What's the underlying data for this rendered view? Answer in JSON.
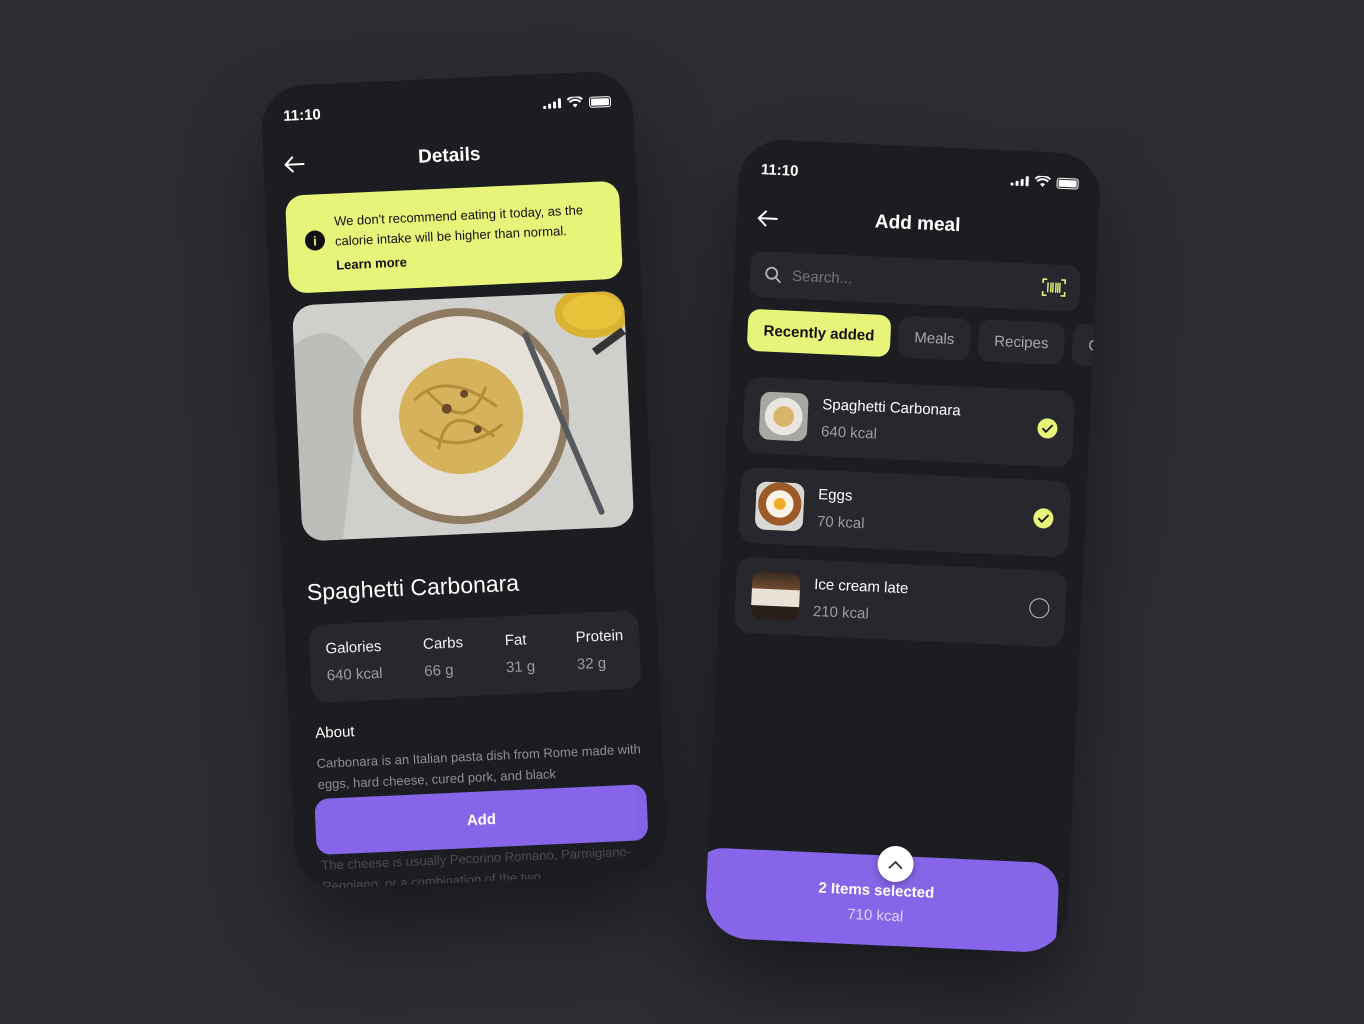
{
  "details_screen": {
    "status_time": "11:10",
    "title": "Details",
    "alert": {
      "message": "We don't recommend eating it today, as the calorie intake will be higher than normal.",
      "link": "Learn more"
    },
    "dish_name": "Spaghetti Carbonara",
    "macros": [
      {
        "label": "Galories",
        "value": "640 kcal"
      },
      {
        "label": "Carbs",
        "value": "66 g"
      },
      {
        "label": "Fat",
        "value": "31 g"
      },
      {
        "label": "Protein",
        "value": "32 g"
      }
    ],
    "about_title": "About",
    "about_text": "Carbonara is an Italian pasta dish from Rome made with eggs, hard cheese, cured pork, and black",
    "about_text_more": "The cheese is usually Pecorino Romano, Parmigiano-Reggiano, or a combination of the two.",
    "add_button": "Add"
  },
  "add_meal_screen": {
    "status_time": "11:10",
    "title": "Add meal",
    "search_placeholder": "Search...",
    "tabs": [
      "Recently added",
      "Meals",
      "Recipes",
      "Cu"
    ],
    "meals": [
      {
        "name": "Spaghetti Carbonara",
        "kcal": "640 kcal",
        "selected": true
      },
      {
        "name": "Eggs",
        "kcal": "70 kcal",
        "selected": true
      },
      {
        "name": "Ice cream late",
        "kcal": "210 kcal",
        "selected": false
      }
    ],
    "selection_count": "2 Items selected",
    "selection_total": "710 kcal"
  },
  "colors": {
    "accent_yellow": "#e6f57a",
    "accent_purple": "#8765e8",
    "background": "#2b2d33",
    "surface": "#1c1d21"
  }
}
